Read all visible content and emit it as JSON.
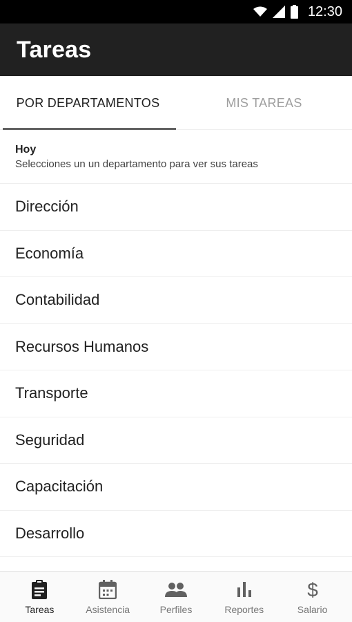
{
  "status_bar": {
    "time": "12:30",
    "icons": [
      "wifi-icon",
      "cell-signal-icon",
      "battery-icon"
    ]
  },
  "app_bar": {
    "title": "Tareas"
  },
  "tabs": [
    {
      "label": "POR DEPARTAMENTOS",
      "active": true
    },
    {
      "label": "MIS TAREAS",
      "active": false
    }
  ],
  "subheader": {
    "heading": "Hoy",
    "hint": "Selecciones un un departamento para ver sus tareas"
  },
  "departments": [
    "Dirección",
    "Economía",
    "Contabilidad",
    "Recursos Humanos",
    "Transporte",
    "Seguridad",
    "Capacitación",
    "Desarrollo"
  ],
  "bottom_nav": [
    {
      "label": "Tareas",
      "icon": "clipboard-icon",
      "active": true
    },
    {
      "label": "Asistencia",
      "icon": "calendar-icon",
      "active": false
    },
    {
      "label": "Perfiles",
      "icon": "people-icon",
      "active": false
    },
    {
      "label": "Reportes",
      "icon": "bar-chart-icon",
      "active": false
    },
    {
      "label": "Salario",
      "icon": "dollar-icon",
      "active": false
    }
  ],
  "colors": {
    "app_bar": "#212121",
    "status_bar": "#000000",
    "active_text": "#212121",
    "inactive_text": "#9e9e9e"
  }
}
